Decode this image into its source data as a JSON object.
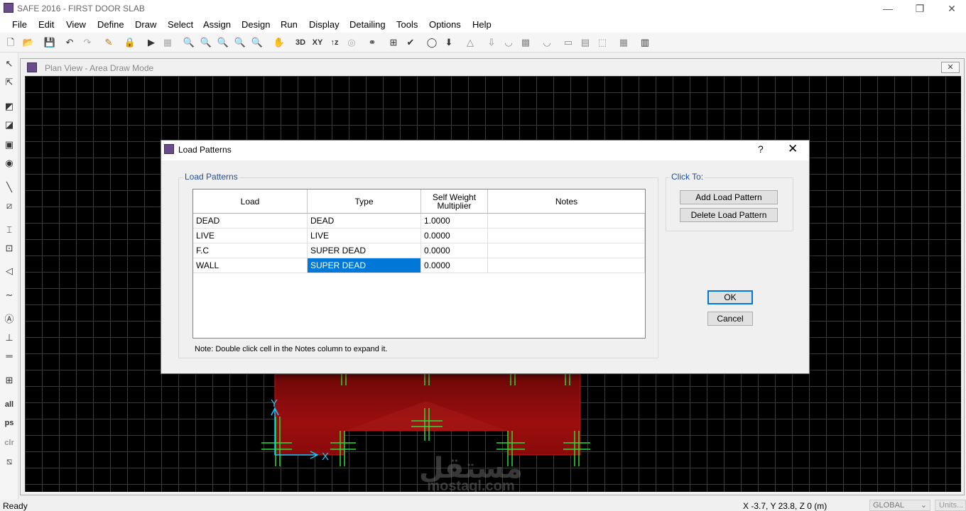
{
  "window": {
    "title": "SAFE 2016 - FIRST DOOR SLAB",
    "minimize": "—",
    "restore": "❐",
    "close": "✕"
  },
  "menu": [
    "File",
    "Edit",
    "View",
    "Define",
    "Draw",
    "Select",
    "Assign",
    "Design",
    "Run",
    "Display",
    "Detailing",
    "Tools",
    "Options",
    "Help"
  ],
  "toolbar": {
    "view_3d": "3D",
    "view_xy": "XY",
    "view_z": "↑z"
  },
  "left_toolbar": {
    "select_all": "all",
    "previous_select": "ps",
    "clear_select": "clr"
  },
  "subwindow": {
    "title": "Plan View - Area Draw Mode",
    "close": "✕"
  },
  "dialog": {
    "title": "Load Patterns",
    "help": "?",
    "close": "✕",
    "group_label": "Load Patterns",
    "columns": [
      "Load",
      "Type",
      "Self Weight\nMultiplier",
      "Notes"
    ],
    "rows": [
      {
        "load": "DEAD",
        "type": "DEAD",
        "multiplier": "1.0000",
        "notes": ""
      },
      {
        "load": "LIVE",
        "type": "LIVE",
        "multiplier": "0.0000",
        "notes": ""
      },
      {
        "load": "F.C",
        "type": "SUPER DEAD",
        "multiplier": "0.0000",
        "notes": ""
      },
      {
        "load": "WALL",
        "type": "SUPER DEAD",
        "multiplier": "0.0000",
        "notes": ""
      }
    ],
    "selected_cell": "WALL / Type",
    "note": "Note:  Double click cell in the Notes column to expand it.",
    "click_to_label": "Click To:",
    "add_button": "Add Load Pattern",
    "delete_button": "Delete Load Pattern",
    "ok_button": "OK",
    "cancel_button": "Cancel"
  },
  "canvas": {
    "axis_x": "X",
    "axis_y": "Y",
    "watermark_text": "mostaql.com",
    "watermark_arabic": "مستقل"
  },
  "status": {
    "ready": "Ready",
    "coords": "X -3.7,  Y 23.8,  Z 0  (m)",
    "coord_system": "GLOBAL",
    "units": "Units..."
  },
  "colors": {
    "slab_fill": "#8a0a0a",
    "rebar": "#2bdc3a",
    "axis": "#19c8ff",
    "selection": "#0078d7",
    "group_label": "#1f4e9a"
  }
}
